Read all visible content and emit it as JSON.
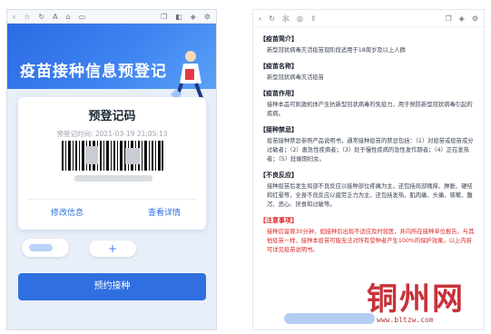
{
  "left": {
    "hero_title": "疫苗接种信息预登记",
    "card": {
      "title": "预登记码",
      "time_label": "预登记时间:",
      "time_value": "2021-03-19 21:05:13",
      "edit_link": "修改信息",
      "detail_link": "查看详情"
    },
    "add_label": "+",
    "primary_button": "预约接种"
  },
  "right": {
    "sections": [
      {
        "heading": "【疫苗简介】",
        "body": "新型冠状病毒灭活疫苗现阶段适用于18周岁及以上人群",
        "warn": false
      },
      {
        "heading": "【疫苗名称】",
        "body": "新型冠状病毒灭活疫苗",
        "warn": false
      },
      {
        "heading": "【疫苗作用】",
        "body": "接种本品可刺激机体产生抗新型冠状病毒的免疫力，用于预防新型冠状病毒引起的疾病。",
        "warn": false
      },
      {
        "heading": "【接种禁忌】",
        "body": "疫苗接种禁忌参照产品说明书，通常接种疫苗的禁忌包括：（1）对疫苗或疫苗成分过敏者；（2）患急性疾病者；（3）处于慢性疾病的急性发作期者；（4）正在发热者；（5）妊娠期妇女。",
        "warn": false
      },
      {
        "heading": "【不良反应】",
        "body": "接种疫苗后发生局部不良反应以接种部位疼痛为主，还包括局部瘙痒、肿胀、硬结和红晕等，全身不良反应以疲劳乏力为主，还包括发热、肌肉痛、头痛、咳嗽、腹泻、恶心、厌食和过敏等。",
        "warn": false
      },
      {
        "heading": "【注意事项】",
        "body": "接种后留观30分钟，如接种后出现不适应及时就医，并向所在接种单位报告。与其他疫苗一样，接种本疫苗可能无法对所有受种者产生100%的保护效果。以上内容可详见疫苗说明书。",
        "warn": true
      }
    ]
  },
  "watermark": {
    "text": "铜州网",
    "url": "www.bltzw.com"
  }
}
